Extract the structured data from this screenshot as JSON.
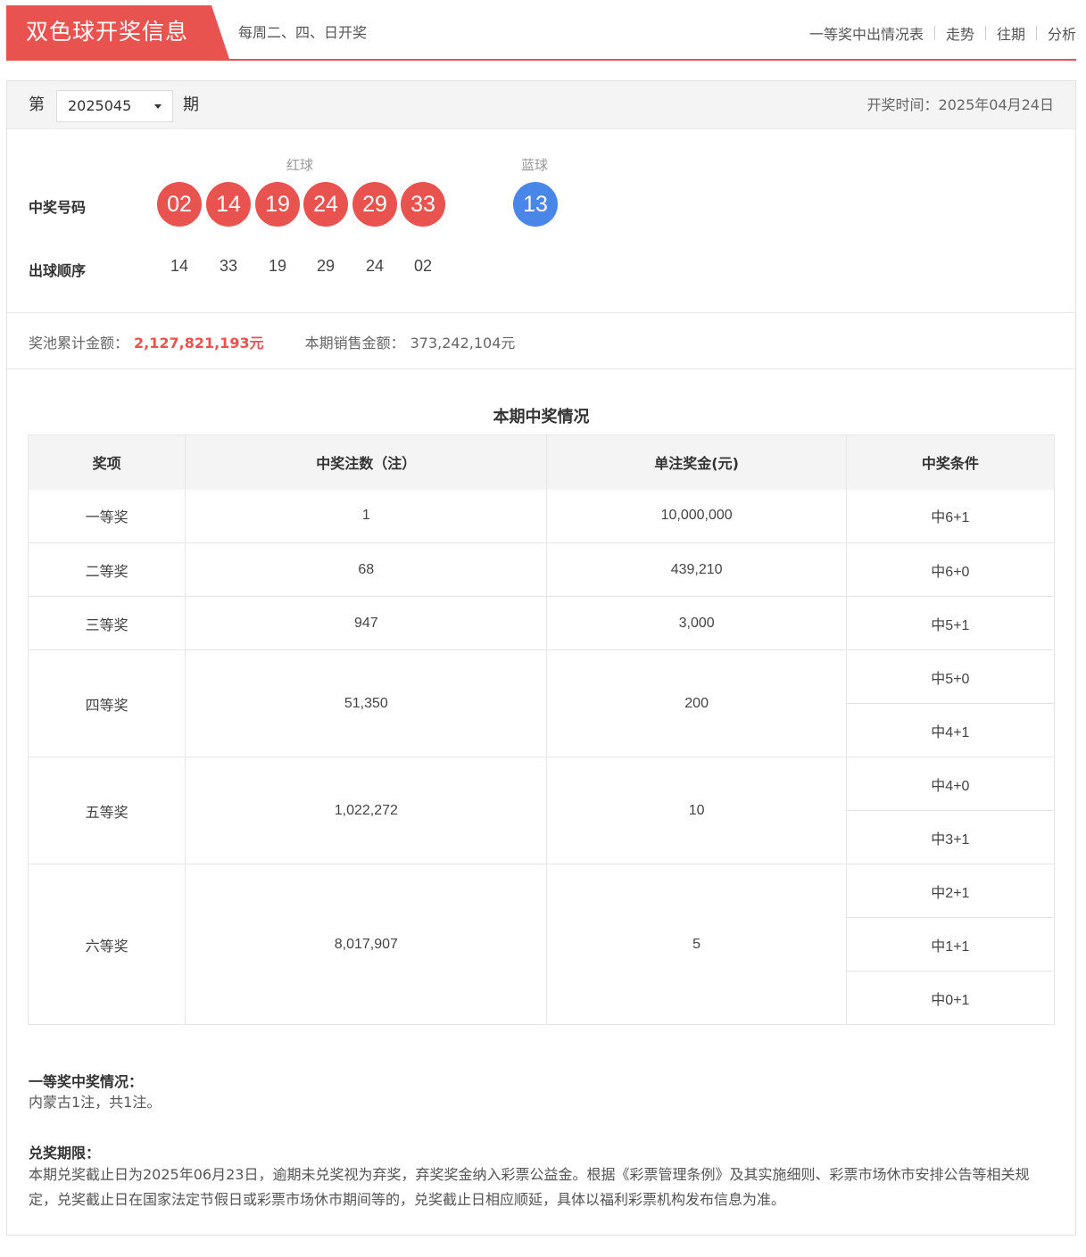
{
  "header": {
    "title": "双色球开奖信息",
    "subtitle": "每周二、四、日开奖",
    "nav": [
      "一等奖中出情况表",
      "走势",
      "往期",
      "分析"
    ]
  },
  "issue": {
    "prefix": "第",
    "value": "2025045",
    "suffix": "期",
    "draw_date_label": "开奖时间：",
    "draw_date": "2025年04月24日"
  },
  "balls": {
    "red_label": "红球",
    "blue_label": "蓝球",
    "win_label": "中奖号码",
    "order_label": "出球顺序",
    "red": [
      "02",
      "14",
      "19",
      "24",
      "29",
      "33"
    ],
    "blue": "13",
    "order": [
      "14",
      "33",
      "19",
      "29",
      "24",
      "02"
    ]
  },
  "pool": {
    "pool_label": "奖池累计金额：",
    "pool_value": "2,127,821,193元",
    "sales_label": "本期销售金额：",
    "sales_value": "373,242,104元"
  },
  "prize_table": {
    "title": "本期中奖情况",
    "headers": [
      "奖项",
      "中奖注数（注）",
      "单注奖金(元)",
      "中奖条件"
    ],
    "rows": [
      {
        "level": "一等奖",
        "count": "1",
        "amount": "10,000,000",
        "conditions": [
          "中6+1"
        ]
      },
      {
        "level": "二等奖",
        "count": "68",
        "amount": "439,210",
        "conditions": [
          "中6+0"
        ]
      },
      {
        "level": "三等奖",
        "count": "947",
        "amount": "3,000",
        "conditions": [
          "中5+1"
        ]
      },
      {
        "level": "四等奖",
        "count": "51,350",
        "amount": "200",
        "conditions": [
          "中5+0",
          "中4+1"
        ]
      },
      {
        "level": "五等奖",
        "count": "1,022,272",
        "amount": "10",
        "conditions": [
          "中4+0",
          "中3+1"
        ]
      },
      {
        "level": "六等奖",
        "count": "8,017,907",
        "amount": "5",
        "conditions": [
          "中2+1",
          "中1+1",
          "中0+1"
        ]
      }
    ]
  },
  "notes": {
    "first_prize_title": "一等奖中奖情况：",
    "first_prize_text": "内蒙古1注，共1注。",
    "deadline_title": "兑奖期限：",
    "deadline_text": "本期兑奖截止日为2025年06月23日，逾期未兑奖视为弃奖，弃奖奖金纳入彩票公益金。根据《彩票管理条例》及其实施细则、彩票市场休市安排公告等相关规定，兑奖截止日在国家法定节假日或彩票市场休市期间等的，兑奖截止日相应顺延，具体以福利彩票机构发布信息为准。"
  }
}
